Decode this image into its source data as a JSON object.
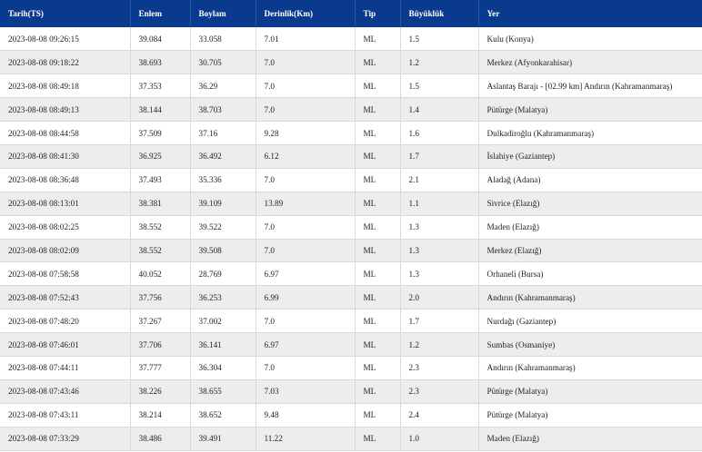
{
  "headers": [
    "Tarih(TS)",
    "Enlem",
    "Boylam",
    "Derinlik(Km)",
    "Tip",
    "Büyüklük",
    "Yer"
  ],
  "rows": [
    [
      "2023-08-08 09:26:15",
      "39.084",
      "33.058",
      "7.01",
      "ML",
      "1.5",
      "Kulu (Konya)"
    ],
    [
      "2023-08-08 09:18:22",
      "38.693",
      "30.705",
      "7.0",
      "ML",
      "1.2",
      "Merkez (Afyonkarahisar)"
    ],
    [
      "2023-08-08 08:49:18",
      "37.353",
      "36.29",
      "7.0",
      "ML",
      "1.5",
      "Aslantaş Barajı - [02.99 km] Andırın (Kahramanmaraş)"
    ],
    [
      "2023-08-08 08:49:13",
      "38.144",
      "38.703",
      "7.0",
      "ML",
      "1.4",
      "Pütürge (Malatya)"
    ],
    [
      "2023-08-08 08:44:58",
      "37.509",
      "37.16",
      "9.28",
      "ML",
      "1.6",
      "Dulkadiroğlu (Kahramanmaraş)"
    ],
    [
      "2023-08-08 08:41:30",
      "36.925",
      "36.492",
      "6.12",
      "ML",
      "1.7",
      "İslahiye (Gaziantep)"
    ],
    [
      "2023-08-08 08:36:48",
      "37.493",
      "35.336",
      "7.0",
      "ML",
      "2.1",
      "Aladağ (Adana)"
    ],
    [
      "2023-08-08 08:13:01",
      "38.381",
      "39.109",
      "13.89",
      "ML",
      "1.1",
      "Sivrice (Elazığ)"
    ],
    [
      "2023-08-08 08:02:25",
      "38.552",
      "39.522",
      "7.0",
      "ML",
      "1.3",
      "Maden (Elazığ)"
    ],
    [
      "2023-08-08 08:02:09",
      "38.552",
      "39.508",
      "7.0",
      "ML",
      "1.3",
      "Merkez (Elazığ)"
    ],
    [
      "2023-08-08 07:58:58",
      "40.052",
      "28.769",
      "6.97",
      "ML",
      "1.3",
      "Orhaneli (Bursa)"
    ],
    [
      "2023-08-08 07:52:43",
      "37.756",
      "36.253",
      "6.99",
      "ML",
      "2.0",
      "Andırın (Kahramanmaraş)"
    ],
    [
      "2023-08-08 07:48:20",
      "37.267",
      "37.002",
      "7.0",
      "ML",
      "1.7",
      "Nurdağı (Gaziantep)"
    ],
    [
      "2023-08-08 07:46:01",
      "37.706",
      "36.141",
      "6.97",
      "ML",
      "1.2",
      "Sumbas (Osmaniye)"
    ],
    [
      "2023-08-08 07:44:11",
      "37.777",
      "36.304",
      "7.0",
      "ML",
      "2.3",
      "Andırın (Kahramanmaraş)"
    ],
    [
      "2023-08-08 07:43:46",
      "38.226",
      "38.655",
      "7.03",
      "ML",
      "2.3",
      "Pütürge (Malatya)"
    ],
    [
      "2023-08-08 07:43:11",
      "38.214",
      "38.652",
      "9.48",
      "ML",
      "2.4",
      "Pütürge (Malatya)"
    ],
    [
      "2023-08-08 07:33:29",
      "38.486",
      "39.491",
      "11.22",
      "ML",
      "1.0",
      "Maden (Elazığ)"
    ]
  ]
}
